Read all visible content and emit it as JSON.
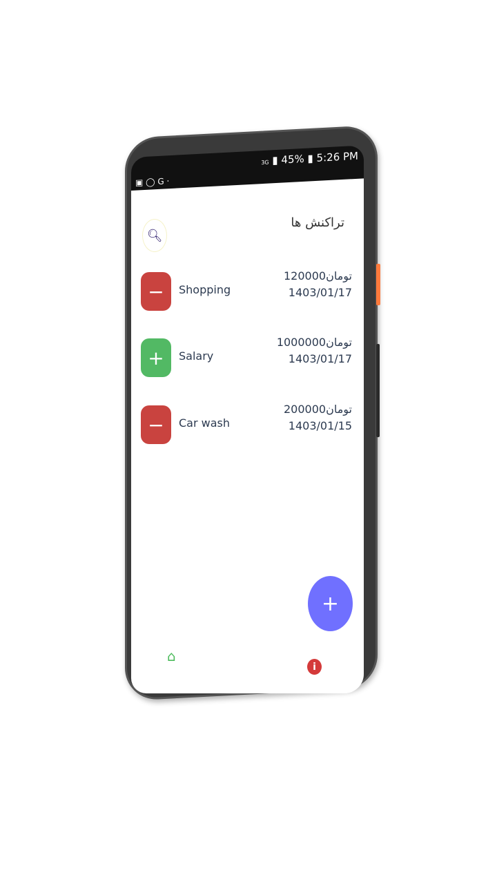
{
  "status_bar": {
    "time": "5:26 PM",
    "battery": "45%",
    "network": "3G"
  },
  "header": {
    "title": "تراکنش ها"
  },
  "transactions": [
    {
      "name": "Shopping",
      "amount": "120000تومان",
      "date": "1403/01/17",
      "type": "expense",
      "sign": "−"
    },
    {
      "name": "Salary",
      "amount": "1000000تومان",
      "date": "1403/01/17",
      "type": "income",
      "sign": "+"
    },
    {
      "name": "Car wash",
      "amount": "200000تومان",
      "date": "1403/01/15",
      "type": "expense",
      "sign": "−"
    }
  ],
  "fab": {
    "label": "+"
  },
  "colors": {
    "expense": "#c9433f",
    "income": "#52b964",
    "fab": "#7070ff"
  }
}
